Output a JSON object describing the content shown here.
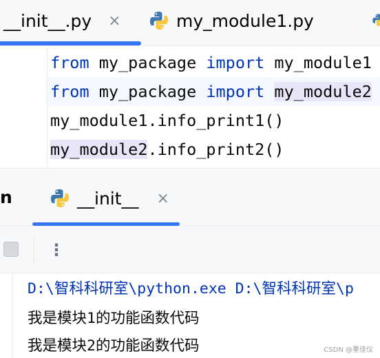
{
  "editor_tabs": [
    {
      "label": "__init__.py",
      "close": "×",
      "active": true
    },
    {
      "label": "my_module1.py",
      "icon": "python-icon"
    }
  ],
  "code_lines": [
    {
      "k1": "from",
      "t1": " my_package ",
      "k2": "import",
      "t2": " my_module1"
    },
    {
      "k1": "from",
      "t1": " my_package ",
      "k2": "import",
      "t2": " ",
      "hl": "my_module2"
    },
    {
      "hl": "",
      "t1": "my_module1.info_print1()"
    },
    {
      "hl": "my_module2",
      "t1": ".info_print2()"
    }
  ],
  "run_panel": {
    "title_fragment": "n",
    "tab": {
      "label": "__init__",
      "close": "×",
      "icon": "python-icon"
    },
    "more_label": "⋮"
  },
  "console": {
    "lines": [
      "D:\\智科科研室\\python.exe D:\\智科科研室\\p",
      "我是模块1的功能函数代码",
      "我是模块2的功能函数代码"
    ]
  },
  "watermark": "CSDN @董佳仪",
  "colors": {
    "keyword": "#0033b3",
    "accent": "#3574f0",
    "reference_highlight": "#e9e5f9",
    "tab_bar_bg": "#f7f8fa"
  }
}
